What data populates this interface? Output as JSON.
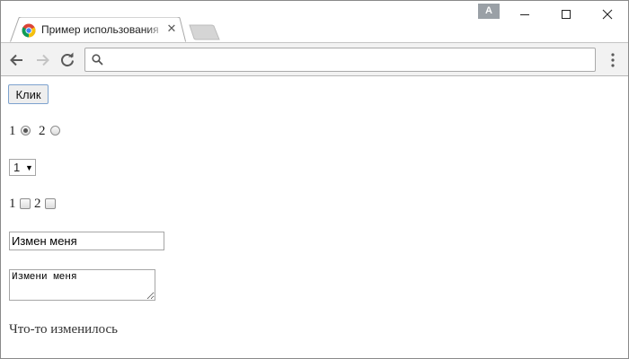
{
  "browser": {
    "tab": {
      "title": "Пример использования",
      "close": "✕"
    },
    "profile_letter": "A",
    "address": {
      "value": ""
    }
  },
  "page": {
    "button_label": "Клик",
    "radios": [
      {
        "label": "1",
        "checked": true
      },
      {
        "label": "2",
        "checked": false
      }
    ],
    "select": {
      "value": "1"
    },
    "checkboxes": [
      {
        "label": "1",
        "checked": false
      },
      {
        "label": "2",
        "checked": false
      }
    ],
    "text_input_value": "Измен меня",
    "textarea_value": "Измени меня",
    "status_text": "Что-то изменилось"
  },
  "icons": {
    "favicon": "chrome-favicon-icon",
    "back": "back-arrow-icon",
    "forward": "forward-arrow-icon",
    "reload": "reload-icon",
    "search": "search-icon",
    "menu": "three-dots-menu-icon",
    "minimize": "minimize-icon",
    "maximize": "maximize-icon",
    "close": "close-icon"
  },
  "colors": {
    "toolbar": "#f2f2f2",
    "button_border": "#7da2ce",
    "profile_badge": "#9aa0a6"
  }
}
